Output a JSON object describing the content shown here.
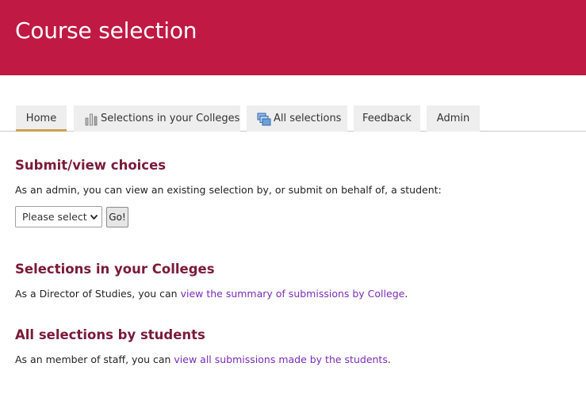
{
  "header": {
    "title": "Course selection",
    "background_color": "#c01944"
  },
  "tabs": [
    {
      "label": "Home",
      "active": true
    },
    {
      "label": "Selections in your Colleges",
      "icon": "bar-chart-icon"
    },
    {
      "label": "All selections",
      "icon": "stacked-windows-icon"
    },
    {
      "label": "Feedback"
    },
    {
      "label": "Admin"
    }
  ],
  "sections": {
    "submit": {
      "heading": "Submit/view choices",
      "text": "As an admin, you can view an existing selection by, or submit on behalf of, a student:",
      "select_value": "Please select",
      "go_label": "Go!"
    },
    "colleges": {
      "heading": "Selections in your Colleges",
      "text_before": "As a Director of Studies, you can ",
      "link": "view the summary of submissions by College",
      "text_after": "."
    },
    "all": {
      "heading": "All selections by students",
      "text_before": "As an member of staff, you can ",
      "link": "view all submissions made by the students",
      "text_after": "."
    }
  },
  "colors": {
    "heading": "#7a1a39",
    "link": "#7a2bb8",
    "active_tab_underline": "#c9a34c"
  }
}
